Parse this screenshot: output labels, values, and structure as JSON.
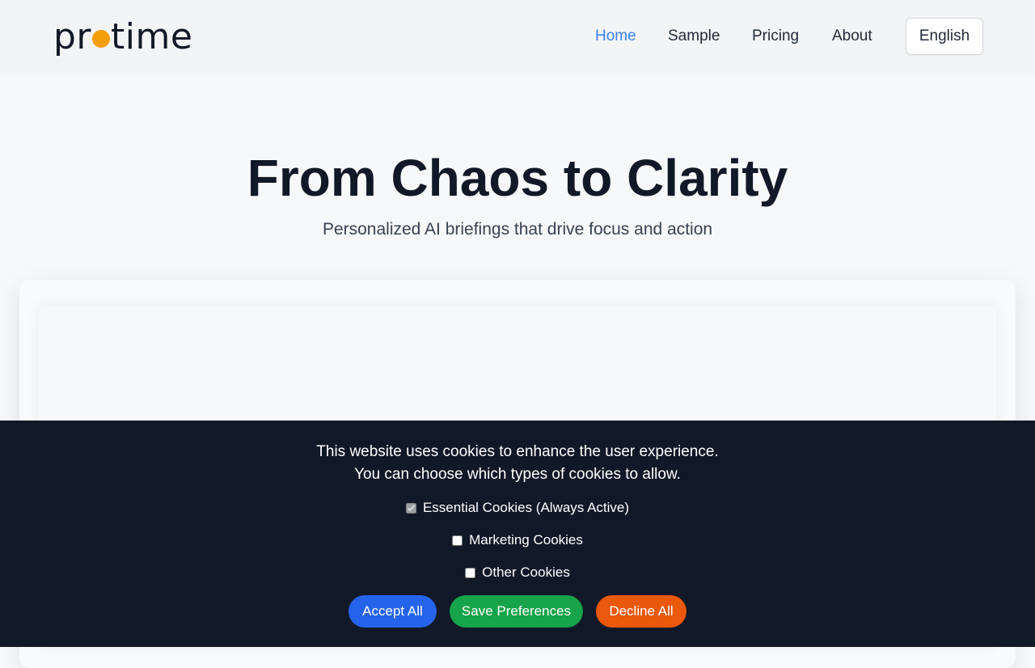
{
  "header": {
    "logo_left": "pr",
    "logo_right": "time",
    "nav": {
      "home": "Home",
      "sample": "Sample",
      "pricing": "Pricing",
      "about": "About"
    },
    "language": "English"
  },
  "hero": {
    "title": "From Chaos to Clarity",
    "subtitle": "Personalized AI briefings that drive focus and action"
  },
  "cookie_banner": {
    "line1": "This website uses cookies to enhance the user experience.",
    "line2": "You can choose which types of cookies to allow.",
    "options": [
      {
        "label": "Essential Cookies (Always Active)",
        "checked": true,
        "disabled": true
      },
      {
        "label": "Marketing Cookies",
        "checked": false,
        "disabled": false
      },
      {
        "label": "Other Cookies",
        "checked": false,
        "disabled": false
      }
    ],
    "buttons": {
      "accept": "Accept All",
      "save": "Save Preferences",
      "decline": "Decline All"
    }
  },
  "colors": {
    "accent_nav": "#3b82f6",
    "logo_dot": "#f59e0b",
    "accept": "#2563eb",
    "save": "#16a34a",
    "decline": "#ea580c",
    "banner_bg": "#111827"
  }
}
